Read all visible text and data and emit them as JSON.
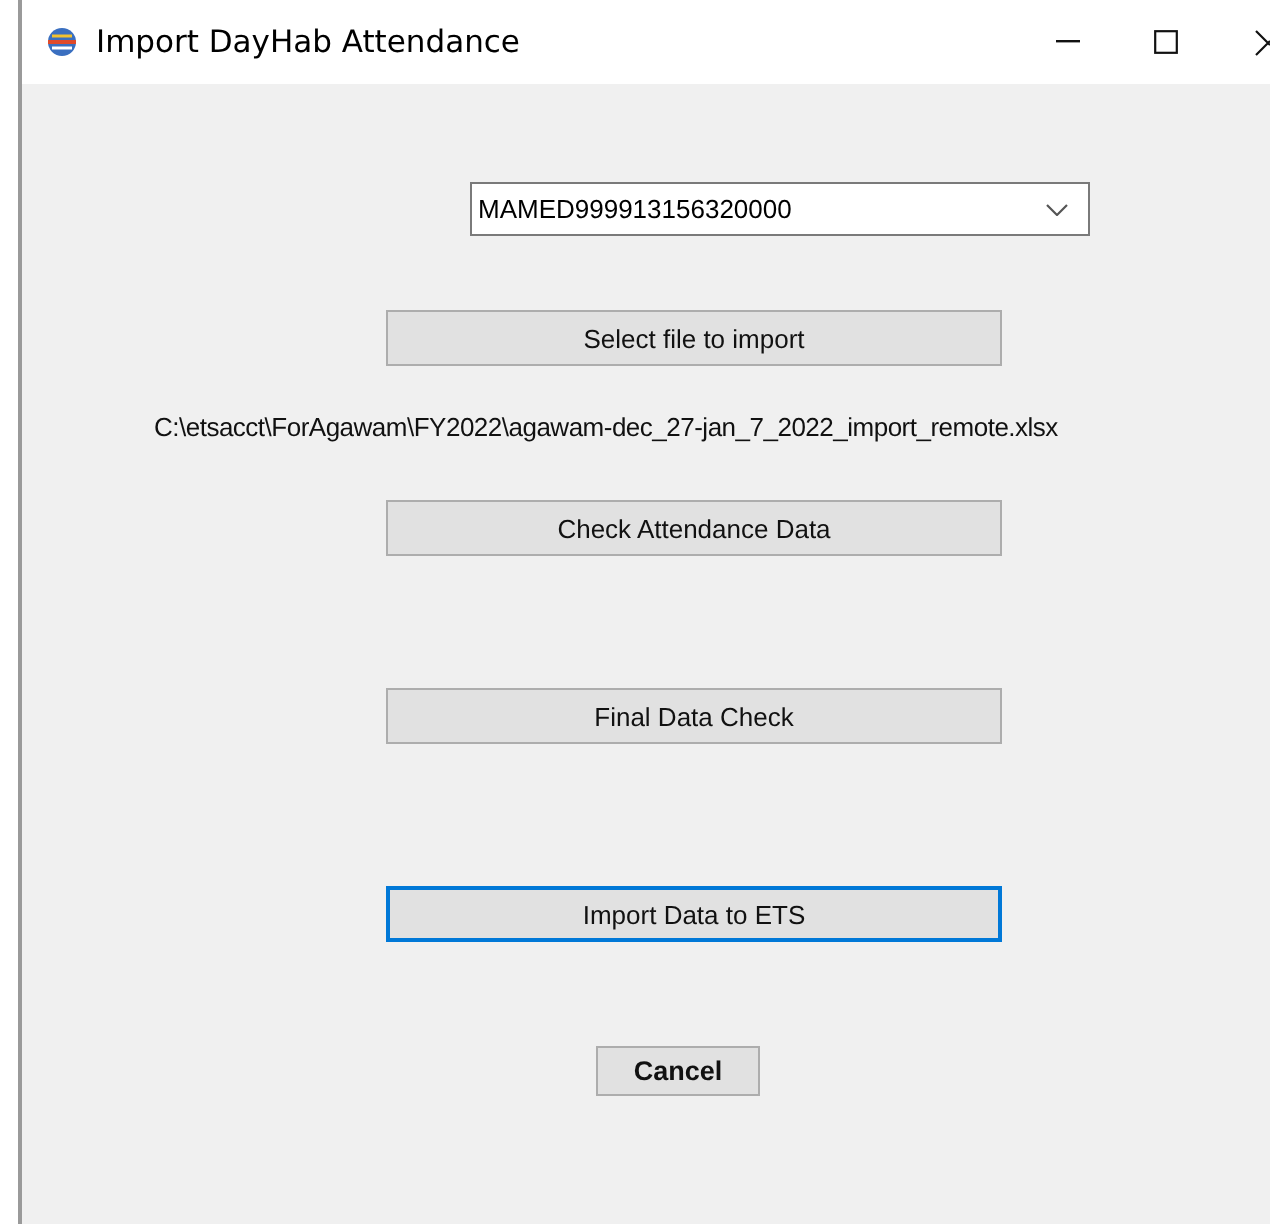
{
  "window": {
    "title": "Import DayHab Attendance"
  },
  "account_select": {
    "value": "MAMED999913156320000"
  },
  "select_file_button": {
    "label": "Select file to import",
    "focused": false
  },
  "file_path": "C:\\etsacct\\ForAgawam\\FY2022\\agawam-dec_27-jan_7_2022_import_remote.xlsx",
  "check_attendance_button": {
    "label": "Check Attendance Data",
    "focused": false
  },
  "final_check_button": {
    "label": "Final Data Check",
    "focused": false
  },
  "import_button": {
    "label": "Import Data to ETS",
    "focused": true
  },
  "cancel_button": {
    "label": "Cancel",
    "focused": false
  }
}
